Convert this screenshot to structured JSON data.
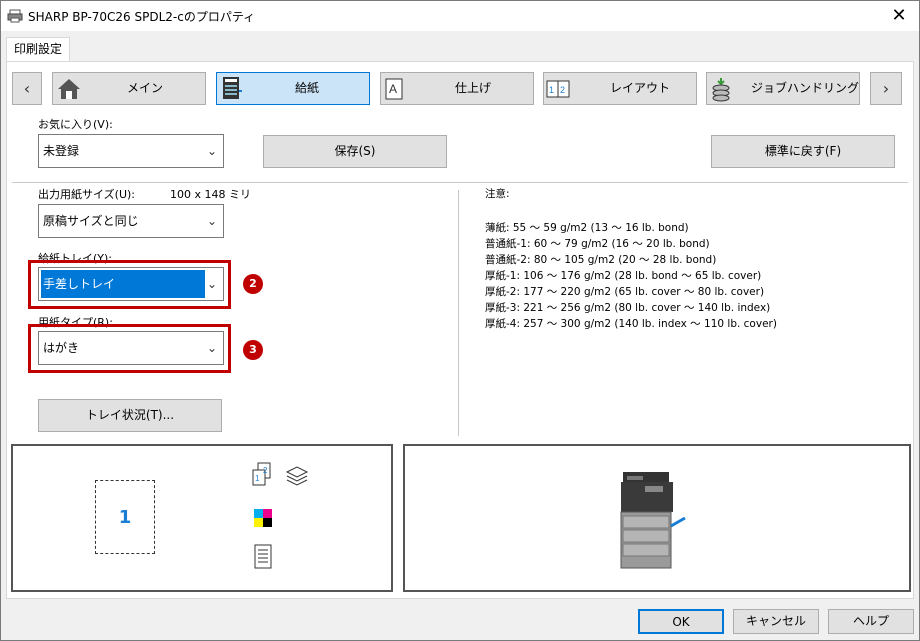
{
  "window": {
    "title": "SHARP BP-70C26 SPDL2-cのプロパティ",
    "close_glyph": "✕"
  },
  "tabs": [
    {
      "label": "印刷設定"
    }
  ],
  "nav": {
    "prev": "‹",
    "next": "›",
    "items": [
      {
        "label": "メイン",
        "icon": "home-icon"
      },
      {
        "label": "給紙",
        "icon": "printer-tray-icon",
        "selected": true
      },
      {
        "label": "仕上げ",
        "icon": "finishing-a-icon"
      },
      {
        "label": "レイアウト",
        "icon": "layout-12-icon"
      },
      {
        "label": "ジョブハンドリング",
        "icon": "job-stack-icon"
      }
    ]
  },
  "favorites": {
    "label": "お気に入り(V):",
    "value": "未登録",
    "save_button": "保存(S)",
    "default_button": "標準に戻す(F)"
  },
  "paper_size": {
    "label": "出力用紙サイズ(U):",
    "size_readout": "100 x 148 ミリ",
    "value": "原稿サイズと同じ"
  },
  "paper_tray": {
    "label": "給紙トレイ(Y):",
    "value": "手差しトレイ",
    "badge": "2"
  },
  "paper_type": {
    "label": "用紙タイプ(R):",
    "value": "はがき",
    "badge": "3"
  },
  "tray_status_button": "トレイ状況(T)...",
  "notes": {
    "heading": "注意:",
    "lines": [
      "薄紙: 55 〜 59 g/m2 (13 〜 16 lb. bond)",
      "普通紙-1: 60 〜 79 g/m2 (16 〜 20 lb. bond)",
      "普通紙-2: 80 〜 105 g/m2 (20 〜 28 lb. bond)",
      "厚紙-1: 106 〜 176 g/m2 (28 lb. bond 〜 65 lb. cover)",
      "厚紙-2: 177 〜 220 g/m2 (65 lb. cover 〜 80 lb. cover)",
      "厚紙-3: 221 〜 256 g/m2 (80 lb. cover 〜 140 lb. index)",
      "厚紙-4: 257 〜 300 g/m2 (140 lb. index 〜 110 lb. cover)"
    ]
  },
  "preview": {
    "page_number": "1"
  },
  "footer": {
    "ok": "OK",
    "cancel": "キャンセル",
    "help": "ヘルプ"
  },
  "colors": {
    "accent": "#0078d7",
    "highlight": "#c00000",
    "page_number": "#1a7fd4"
  }
}
